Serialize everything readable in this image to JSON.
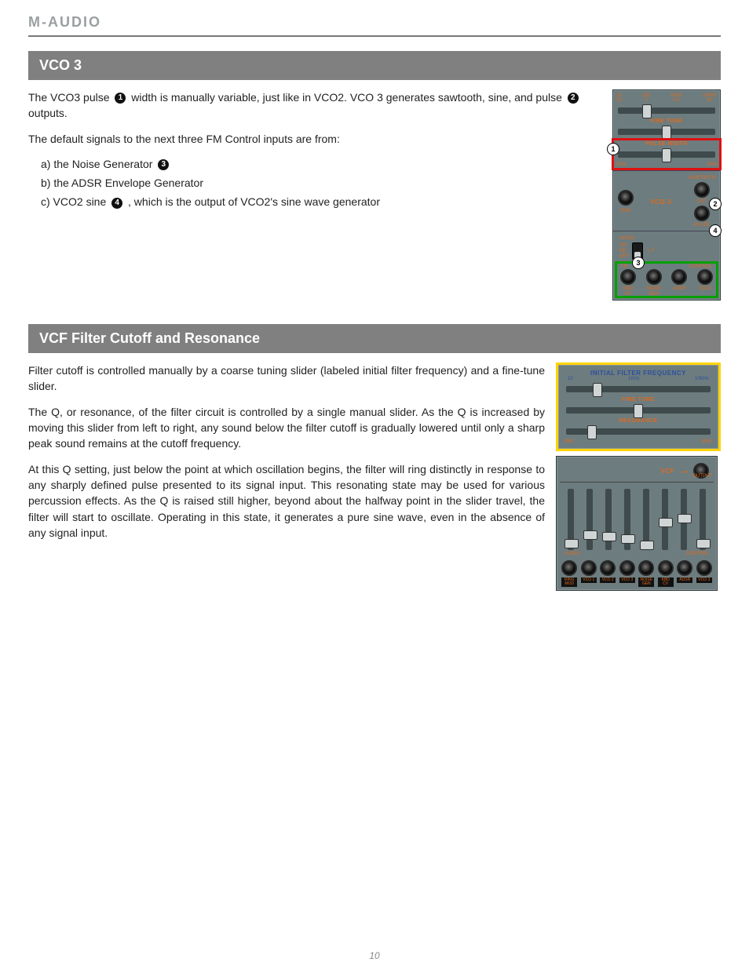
{
  "brand": "M-AUDIO",
  "page_number": "10",
  "vco3": {
    "title": "VCO 3",
    "p1a": "The VCO3 pulse ",
    "p1b": " width is manually variable, just like in VCO2. VCO 3 generates sawtooth, sine, and pulse ",
    "p1c": " outputs.",
    "p2": "The default signals to the next three FM Control inputs are from:",
    "li_a_pre": "a)  the Noise Generator ",
    "li_b": "b)  the ADSR Envelope Generator",
    "li_c_pre": "c)  VCO2 sine ",
    "li_c_post": ", which is the output of VCO2's sine wave generator",
    "badge1": "1",
    "badge2": "2",
    "badge3": "3",
    "badge4": "4"
  },
  "vco3panel": {
    "ticks": [
      "10\n03",
      "100\n3",
      "1KHz\n3.0",
      "10KHz\n30."
    ],
    "fine_tune": "FINE TUNE",
    "pulse_width": "PULSE WIDTH",
    "pw_min": "10%",
    "pw_max": "90%",
    "sawtooth": "SAWTOOTH",
    "vco3": "VCO-3",
    "out": "OUT",
    "sine": "SINE",
    "pulse": "PULSE",
    "audio": "AUDIO",
    "on": "ON",
    "kb": "KB",
    "off": "OFF",
    "lf": "L F",
    "fm": "FM",
    "control": "CONTROL",
    "j1": "KBD\nCV",
    "j2": "NOISE\nGEN",
    "j3": "ADSR",
    "j4": "VCO2"
  },
  "vcf": {
    "title": "VCF Filter Cutoff and Resonance",
    "p1": "Filter cutoff is controlled manually by a coarse tuning slider (labeled initial filter frequency) and a fine-tune slider.",
    "p2": "The Q, or resonance, of the filter circuit is controlled by a single manual slider. As the Q is increased by moving this slider from left to right, any sound below the filter cutoff is gradually lowered until only a sharp peak sound remains at the cutoff frequency.",
    "p3": "At this Q setting, just below the point at which oscillation begins, the filter will ring distinctly in response to any sharply defined pulse presented to its signal input. This resonating state may be used for various percussion effects. As the Q is raised still higher, beyond about the halfway point in the slider travel, the filter will start to oscillate. Operating in this state, it generates a pure sine wave, even in the absence of any signal input."
  },
  "vcf1": {
    "iff": "INITIAL FILTER FREQUENCY",
    "ticks": [
      "10",
      "1KHz",
      "10KHz"
    ],
    "fine": "FINE TUNE",
    "res": "RESONANCE",
    "min": "MIN",
    "max": "MAX"
  },
  "vcf2": {
    "vcf": "VCF",
    "output": "OUTPUT",
    "audio": "AUDIO",
    "control": "CONTROL",
    "b1": "RING\nMOD",
    "b2": "VCO 1",
    "b3": "VCO 2",
    "b4": "VCO 3",
    "b5": "NOISE\nGEN",
    "b6": "KBD\nCV",
    "b7": "ADSR",
    "b8": "VCO 3",
    "slider_pos": [
      90,
      75,
      78,
      82,
      92,
      55,
      48,
      90
    ]
  }
}
